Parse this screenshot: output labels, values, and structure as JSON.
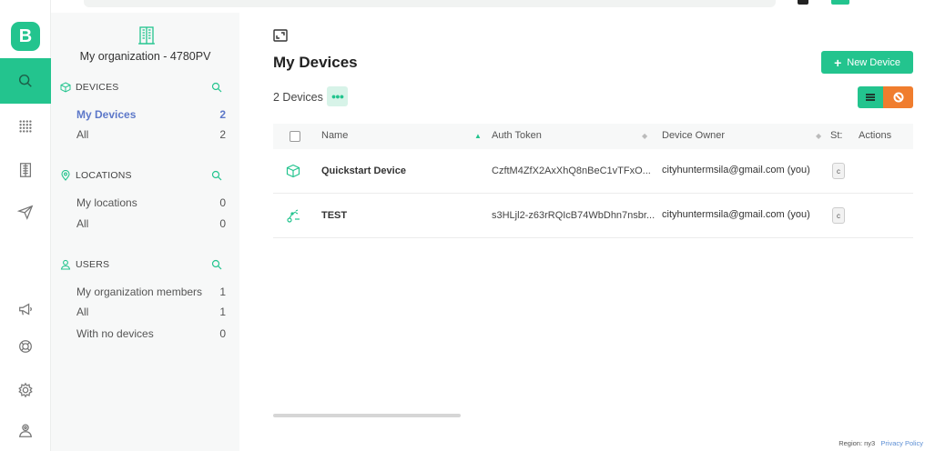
{
  "app": {
    "logo_letter": "B",
    "accent": "#23c48e"
  },
  "rail": {
    "items": [
      {
        "name": "search-icon",
        "active": true
      },
      {
        "name": "grid-icon"
      },
      {
        "name": "building-icon"
      },
      {
        "name": "send-icon"
      },
      {
        "name": "megaphone-icon"
      },
      {
        "name": "lifebuoy-icon"
      },
      {
        "name": "gear-icon"
      },
      {
        "name": "user-badge-icon"
      }
    ]
  },
  "sidebar": {
    "org_name": "My organization - 4780PV",
    "sections": [
      {
        "title": "DEVICES",
        "icon": "cube-icon",
        "rows": [
          {
            "label": "My Devices",
            "count": "2",
            "active": true
          },
          {
            "label": "All",
            "count": "2"
          }
        ]
      },
      {
        "title": "LOCATIONS",
        "icon": "pin-icon",
        "rows": [
          {
            "label": "My locations",
            "count": "0"
          },
          {
            "label": "All",
            "count": "0"
          }
        ]
      },
      {
        "title": "USERS",
        "icon": "user-icon",
        "rows": [
          {
            "label": "My organization members",
            "count": "1"
          },
          {
            "label": "All",
            "count": "1"
          },
          {
            "label": "With no devices",
            "count": "0"
          }
        ]
      }
    ]
  },
  "main": {
    "title": "My Devices",
    "new_device_label": "New Device",
    "device_count": "2 Devices",
    "columns": {
      "name": "Name",
      "auth_token": "Auth Token",
      "owner": "Device Owner",
      "status": "St:",
      "actions": "Actions"
    },
    "rows": [
      {
        "icon": "cube-icon",
        "name": "Quickstart Device",
        "token": "CzftM4ZfX2AxXhQ8nBeC1vTFxO...",
        "owner": "cityhuntermsila@gmail.com (you)",
        "status": "c"
      },
      {
        "icon": "robot-arm-icon",
        "name": "TEST",
        "token": "s3HLjl2-z63rRQIcB74WbDhn7nsbr...",
        "owner": "cityhuntermsila@gmail.com (you)",
        "status": "c"
      }
    ]
  },
  "footer": {
    "region": "Region: ny3",
    "privacy": "Privacy Policy"
  }
}
